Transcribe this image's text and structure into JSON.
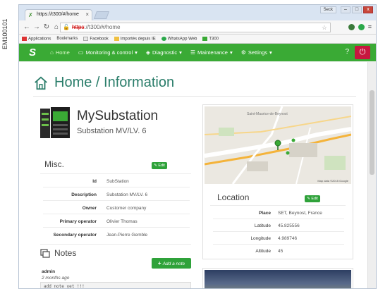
{
  "side_code": "EM100101",
  "browser": {
    "tab_title": "https://t300/#/home",
    "tab_close": "×",
    "user_badge": "Seck",
    "win_min": "–",
    "win_max": "□",
    "win_close": "x",
    "url_host": "https",
    "url_rest": "://t300/#/home",
    "bookmarks": [
      "Applications",
      "Bookmarks",
      "Facebook",
      "Importés depuis IE",
      "WhatsApp Web",
      "T300"
    ]
  },
  "nav": {
    "items": [
      {
        "label": "Home",
        "icon": "home-icon"
      },
      {
        "label": "Monitoring & control",
        "icon": "monitor-icon"
      },
      {
        "label": "Diagnostic",
        "icon": "diagnostic-icon"
      },
      {
        "label": "Maintenance",
        "icon": "maintenance-icon"
      },
      {
        "label": "Settings",
        "icon": "settings-icon"
      }
    ],
    "help": "?",
    "colors": {
      "bar": "#3aaa35",
      "logout": "#c7173f"
    }
  },
  "page": {
    "title": "Home / Information",
    "accent": "#2a7d6a"
  },
  "substation": {
    "name": "MySubstation",
    "type": "Substation MV/LV. 6"
  },
  "misc": {
    "title": "Misc.",
    "edit_label": "Edit",
    "rows": [
      {
        "key": "Id",
        "value": "SubStation"
      },
      {
        "key": "Description",
        "value": "Substation MV/LV. 6"
      },
      {
        "key": "Owner",
        "value": "Customer company"
      },
      {
        "key": "Primary operator",
        "value": "Olivier Thomas"
      },
      {
        "key": "Secondary operator",
        "value": "Jean-Pierre Gemble"
      }
    ]
  },
  "notes": {
    "title": "Notes",
    "add_label": "Add a note",
    "author": "admin",
    "time": "2 months ago",
    "text": "add note yet !!!"
  },
  "location": {
    "title": "Location",
    "edit_label": "Edit",
    "map_label": "Saint-Maurice-de-Beynost",
    "map_credit": "Map data ©2015 Google",
    "rows": [
      {
        "key": "Place",
        "value": "SET, Beynost, France"
      },
      {
        "key": "Latitude",
        "value": "45.825556"
      },
      {
        "key": "Longitude",
        "value": "4.989746"
      },
      {
        "key": "Altitude",
        "value": "45"
      }
    ]
  }
}
